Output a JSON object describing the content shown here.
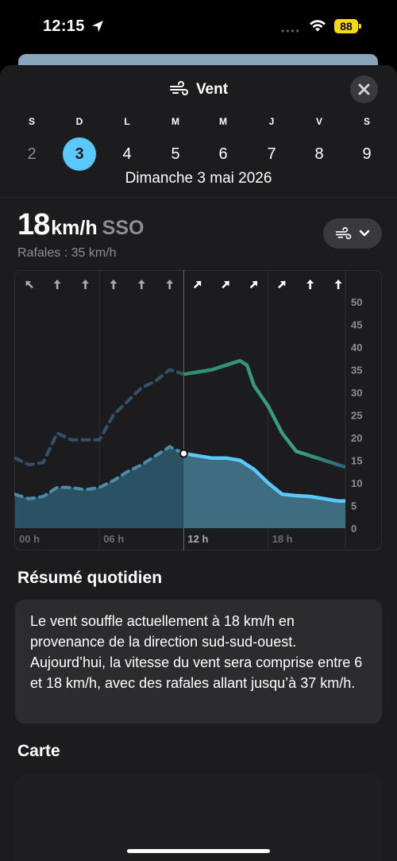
{
  "status_bar": {
    "time": "12:15",
    "battery": "88"
  },
  "sheet": {
    "title": "Vent",
    "close_icon": "xmark-icon"
  },
  "days": [
    {
      "letter": "S",
      "number": "2",
      "state": "past"
    },
    {
      "letter": "D",
      "number": "3",
      "state": "selected"
    },
    {
      "letter": "L",
      "number": "4",
      "state": "future"
    },
    {
      "letter": "M",
      "number": "5",
      "state": "future"
    },
    {
      "letter": "M",
      "number": "6",
      "state": "future"
    },
    {
      "letter": "J",
      "number": "7",
      "state": "future"
    },
    {
      "letter": "V",
      "number": "8",
      "state": "future"
    },
    {
      "letter": "S",
      "number": "9",
      "state": "future"
    }
  ],
  "selected_date": "Dimanche 3 mai 2026",
  "current": {
    "speed": "18",
    "unit": "km/h",
    "direction": "SSO",
    "gusts": "Rafales : 35 km/h"
  },
  "chart_data": {
    "type": "area",
    "x_unit": "hour",
    "xlim": [
      0,
      23.5
    ],
    "ylim": [
      0,
      50
    ],
    "y_ticks": [
      "50",
      "45",
      "40",
      "35",
      "30",
      "25",
      "20",
      "15",
      "10",
      "5",
      "0"
    ],
    "x_ticks": [
      {
        "hour": 0,
        "label": "00 h"
      },
      {
        "hour": 6,
        "label": "06 h"
      },
      {
        "hour": 12,
        "label": "12 h"
      },
      {
        "hour": 18,
        "label": "18 h"
      }
    ],
    "current_hour": 12,
    "direction_arrows": [
      {
        "hour": 1,
        "rotation": -45
      },
      {
        "hour": 3,
        "rotation": 0
      },
      {
        "hour": 5,
        "rotation": 0
      },
      {
        "hour": 7,
        "rotation": 0
      },
      {
        "hour": 9,
        "rotation": 0
      },
      {
        "hour": 11,
        "rotation": 0
      },
      {
        "hour": 13,
        "rotation": 45
      },
      {
        "hour": 15,
        "rotation": 45
      },
      {
        "hour": 17,
        "rotation": 45
      },
      {
        "hour": 19,
        "rotation": 45
      },
      {
        "hour": 21,
        "rotation": 0
      },
      {
        "hour": 23,
        "rotation": 0
      }
    ],
    "series": [
      {
        "name": "Rafales",
        "color": "#3d9a78",
        "x": [
          0,
          1,
          2,
          3,
          4,
          5,
          6,
          7,
          8,
          9,
          10,
          11,
          12,
          13,
          14,
          15,
          16,
          16.5,
          17,
          18,
          19,
          20,
          21,
          22,
          23,
          23.5
        ],
        "values": [
          15.5,
          14,
          14.5,
          21,
          19.5,
          19.5,
          19.5,
          25,
          28,
          31,
          32.5,
          35,
          34,
          34.5,
          35,
          36,
          37,
          36,
          31.5,
          27,
          21,
          17,
          16,
          15,
          14,
          13.5
        ]
      },
      {
        "name": "Vent",
        "color": "#5ac8fa",
        "x": [
          0,
          1,
          2,
          3,
          4,
          5,
          6,
          7,
          8,
          9,
          10,
          11,
          12,
          13,
          14,
          15,
          16,
          17,
          18,
          19,
          20,
          21,
          22,
          23,
          23.5
        ],
        "values": [
          7.5,
          6.5,
          7,
          9,
          9,
          8.5,
          9,
          10.5,
          12.5,
          14,
          16,
          18,
          16.5,
          16,
          15.5,
          15.5,
          15,
          13,
          10,
          7.5,
          7.2,
          7,
          6.5,
          6,
          6
        ]
      }
    ]
  },
  "summary": {
    "heading": "Résumé quotidien",
    "text": "Le vent souffle actuellement à 18 km/h en provenance de la direction sud-sud-ouest. Aujourd’hui, la vitesse du vent sera comprise entre 6 et 18 km/h, avec des rafales allant jusqu’à 37 km/h."
  },
  "map": {
    "heading": "Carte"
  }
}
